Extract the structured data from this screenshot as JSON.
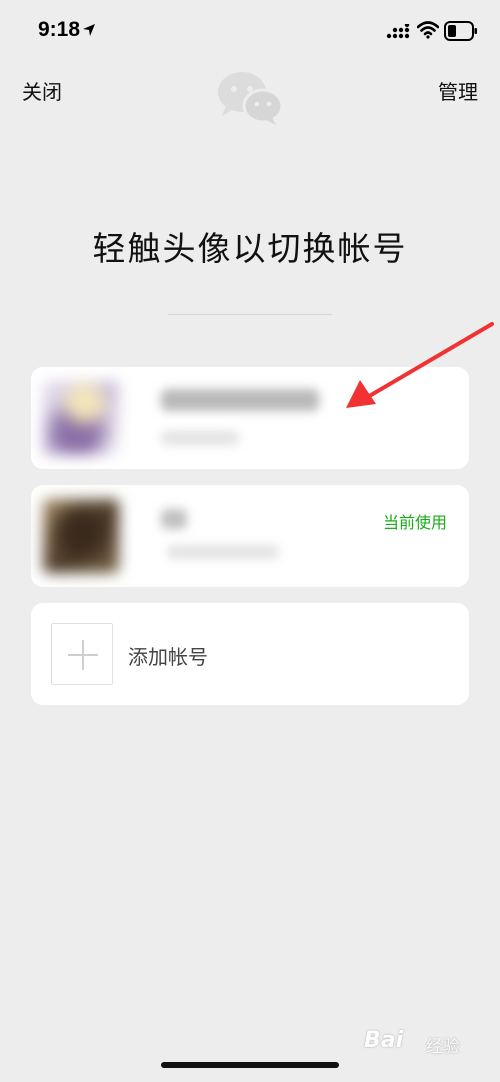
{
  "status_bar": {
    "time": "9:18",
    "icons": [
      "location-arrow-icon",
      "signal-icon",
      "wifi-icon",
      "battery-icon"
    ],
    "battery_level": 0.3
  },
  "nav": {
    "left_label": "关闭",
    "right_label": "管理",
    "logo_icon": "wechat-logo-icon"
  },
  "title": "轻触头像以切换帐号",
  "accounts": [
    {
      "status": ""
    },
    {
      "status": "当前使用"
    }
  ],
  "add_account": {
    "label": "添加帐号",
    "icon": "plus-icon"
  },
  "annotation": {
    "icon": "red-arrow-icon",
    "color": "#f03232"
  },
  "watermark": {
    "brand": "Bai",
    "text": "经验"
  },
  "colors": {
    "background": "#ededed",
    "accent_green": "#1aad19",
    "card": "#ffffff"
  }
}
